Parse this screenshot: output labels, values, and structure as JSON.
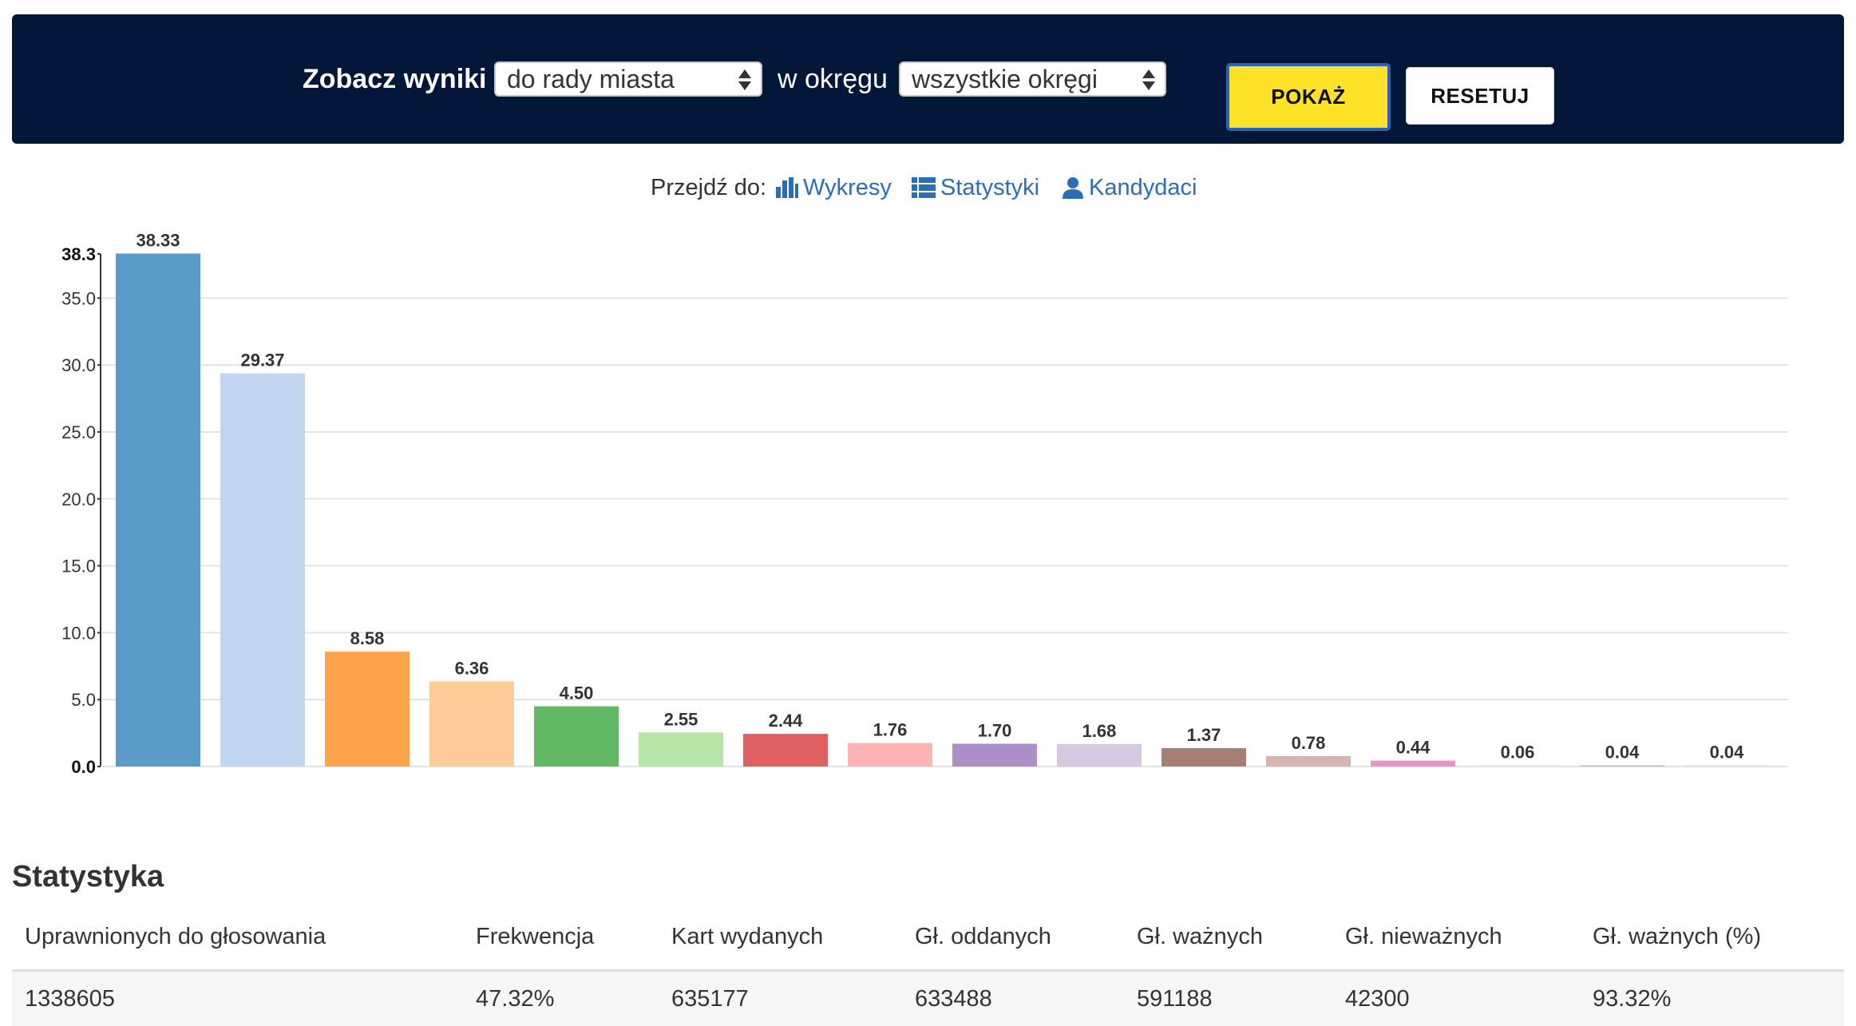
{
  "filter": {
    "label_results": "Zobacz wyniki",
    "select_type": "do rady miasta",
    "label_district": "w okręgu",
    "select_district": "wszystkie okręgi",
    "show_button": "POKAŻ",
    "reset_button": "RESETUJ"
  },
  "nav": {
    "prefix": "Przejdź do:",
    "charts": "Wykresy",
    "stats": "Statystyki",
    "candidates": "Kandydaci"
  },
  "colors": {
    "bar_series": [
      "#5b9bcb",
      "#c2d5ee",
      "#ffa24a",
      "#ffcc98",
      "#63b863",
      "#b6e6a6",
      "#e05f60",
      "#fdb4b3",
      "#ab8fc9",
      "#d5c9e0",
      "#a87f77",
      "#d6b5b0",
      "#ec90c8",
      "#f8d6e9",
      "#bdbdbd",
      "#dcdcdc"
    ],
    "header_bg": "#031838",
    "accent_button": "#fee227",
    "link": "#2a6eb3"
  },
  "chart_data": {
    "type": "bar",
    "categories": [
      "",
      "",
      "",
      "",
      "",
      "",
      "",
      "",
      "",
      "",
      "",
      "",
      "",
      "",
      "",
      ""
    ],
    "values": [
      38.33,
      29.37,
      8.58,
      6.36,
      4.5,
      2.55,
      2.44,
      1.76,
      1.7,
      1.68,
      1.37,
      0.78,
      0.44,
      0.06,
      0.04,
      0.04
    ],
    "value_labels": [
      "38.33",
      "29.37",
      "8.58",
      "6.36",
      "4.50",
      "2.55",
      "2.44",
      "1.76",
      "1.70",
      "1.68",
      "1.37",
      "0.78",
      "0.44",
      "0.06",
      "0.04",
      "0.04"
    ],
    "ylim": [
      0,
      38.3
    ],
    "yticks": [
      "0.0",
      "5.0",
      "10.0",
      "15.0",
      "20.0",
      "25.0",
      "30.0",
      "35.0",
      "38.3"
    ],
    "ytick_values": [
      0,
      5,
      10,
      15,
      20,
      25,
      30,
      35,
      38.3
    ],
    "grid": true,
    "title": "",
    "xlabel": "",
    "ylabel": ""
  },
  "stats": {
    "title": "Statystyka",
    "headers": [
      "Uprawnionych do głosowania",
      "Frekwencja",
      "Kart wydanych",
      "Gł. oddanych",
      "Gł. ważnych",
      "Gł. nieważnych",
      "Gł. ważnych (%)"
    ],
    "row": [
      "1338605",
      "47.32%",
      "635177",
      "633488",
      "591188",
      "42300",
      "93.32%"
    ]
  }
}
